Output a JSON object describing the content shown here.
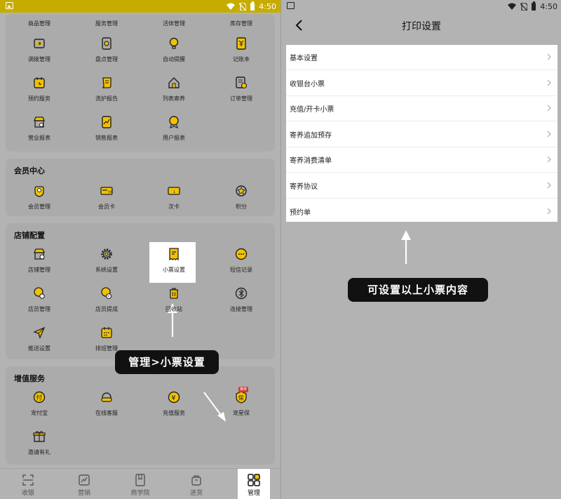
{
  "status": {
    "time": "4:50"
  },
  "left": {
    "top_row": [
      "商品管理",
      "服务管理",
      "活体管理",
      "库存管理"
    ],
    "reports": [
      {
        "label": "调拨管理",
        "icon": "transfer-icon"
      },
      {
        "label": "盘点管理",
        "icon": "inventory-check-icon"
      },
      {
        "label": "自动提醒",
        "icon": "bulb-icon"
      },
      {
        "label": "记账本",
        "icon": "ledger-icon"
      },
      {
        "label": "预约服务",
        "icon": "calendar-icon"
      },
      {
        "label": "洗护报告",
        "icon": "scroll-icon"
      },
      {
        "label": "列表寄养",
        "icon": "house-icon"
      },
      {
        "label": "订单管理",
        "icon": "order-icon"
      },
      {
        "label": "营业报表",
        "icon": "store-report-icon"
      },
      {
        "label": "销售报表",
        "icon": "sales-chart-icon"
      },
      {
        "label": "用户报表",
        "icon": "user-badge-icon"
      }
    ],
    "member": {
      "title": "会员中心",
      "items": [
        {
          "label": "会员管理",
          "icon": "member-icon"
        },
        {
          "label": "会员卡",
          "icon": "vip-card-icon"
        },
        {
          "label": "次卡",
          "icon": "count-card-icon"
        },
        {
          "label": "积分",
          "icon": "points-icon"
        }
      ]
    },
    "store": {
      "title": "店铺配置",
      "items": [
        {
          "label": "店铺管理",
          "icon": "shop-settings-icon"
        },
        {
          "label": "系统设置",
          "icon": "gear-icon"
        },
        {
          "label": "小票设置",
          "icon": "receipt-icon"
        },
        {
          "label": "短信记录",
          "icon": "message-icon"
        },
        {
          "label": "店员管理",
          "icon": "staff-icon"
        },
        {
          "label": "店员提成",
          "icon": "commission-icon"
        },
        {
          "label": "回收站",
          "icon": "trash-icon"
        },
        {
          "label": "连接管理",
          "icon": "bluetooth-icon"
        },
        {
          "label": "推送设置",
          "icon": "send-icon"
        },
        {
          "label": "排班管理",
          "icon": "schedule-icon"
        }
      ]
    },
    "value_added": {
      "title": "增值服务",
      "items": [
        {
          "label": "宠付宝",
          "icon": "pay-icon"
        },
        {
          "label": "在线客服",
          "icon": "headset-icon"
        },
        {
          "label": "充值服务",
          "icon": "yen-icon"
        },
        {
          "label": "宠星保",
          "icon": "insurance-icon",
          "badge": "推荐"
        },
        {
          "label": "邀请有礼",
          "icon": "gift-icon"
        }
      ]
    },
    "tabs": [
      {
        "label": "收银",
        "icon": "scan-icon"
      },
      {
        "label": "营销",
        "icon": "trend-icon"
      },
      {
        "label": "商学院",
        "icon": "book-icon"
      },
      {
        "label": "进货",
        "icon": "bag-icon"
      },
      {
        "label": "管理",
        "icon": "grid-icon",
        "active": true
      }
    ],
    "callout": "管理>小票设置"
  },
  "right": {
    "title": "打印设置",
    "rows": [
      "基本设置",
      "收银台小票",
      "充值/开卡小票",
      "寄养追加预存",
      "寄养消费清单",
      "寄养协议",
      "预约单"
    ],
    "callout": "可设置以上小票内容"
  },
  "colors": {
    "accent": "#f2c200",
    "icon_stroke": "#222222",
    "callout_bg": "#111111"
  }
}
